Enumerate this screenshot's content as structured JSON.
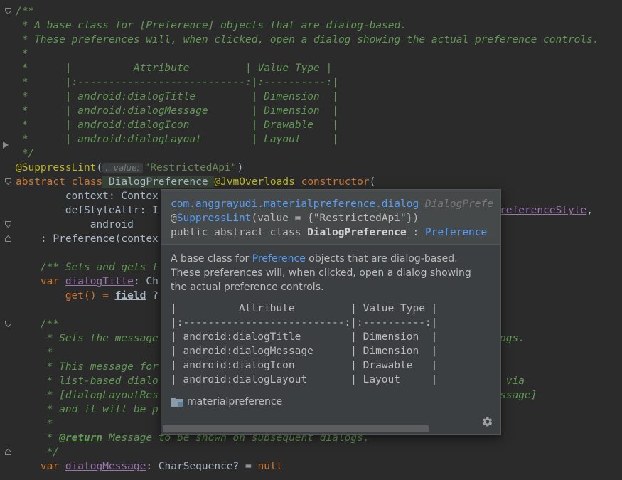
{
  "editor": {
    "lines": {
      "l1": "/**",
      "l2": " * A base class for [Preference] objects that are dialog-based.",
      "l3": " * These preferences will, when clicked, open a dialog showing the actual preference controls.",
      "l4": " *",
      "l5": " *      |          Attribute         | Value Type |",
      "l6": " *      |:---------------------------:|:----------:|",
      "l7": " *      | android:dialogTitle         | Dimension  |",
      "l8": " *      | android:dialogMessage       | Dimension  |",
      "l9": " *      | android:dialogIcon          | Drawable   |",
      "l10": " *      | android:dialogLayout        | Layout     |",
      "l11": " */",
      "l12_ann": "@SuppressLint",
      "l12_open": "(",
      "l12_hint": "...value:",
      "l12_str": "\"RestrictedApi\"",
      "l12_close": ")",
      "l13_kw1": "abstract class",
      "l13_name": " DialogPreference ",
      "l13_ann": "@JvmOverloads",
      "l13_kw2": " constructor",
      "l13_rest": "(",
      "l14": "        context: Contex",
      "l15": "        defStyleAttr: I",
      "l15_right": "referenceStyle",
      "l15_tail": ",",
      "l16": "            android",
      "l17": "    : Preference(contex",
      "l19": "    /** Sets and gets t",
      "l20_kw": "    var ",
      "l20_prop": "dialogTitle",
      "l20_rest": ": Ch",
      "l21_a": "        get() = ",
      "l21_field": "field",
      "l21_b": " ?",
      "l23": "    /**",
      "l24": "     * Sets the message",
      "l24_right": "ogs.",
      "l25": "     *",
      "l26": "     * This message for",
      "l27": "     * list-based dialo",
      "l27_right": " via",
      "l28": "     * [dialogLayoutRes",
      "l28_right": "ssage]",
      "l29": "     * and it will be p",
      "l30": "     *",
      "l31_star": "     * ",
      "l31_tag": "@return",
      "l31_rest": " Message to be shown on subsequent dialogs.",
      "l32": "     */",
      "l33_kw": "    var ",
      "l33_prop": "dialogMessage",
      "l33_rest": ": CharSequence? = ",
      "l33_null": "null"
    }
  },
  "quick_doc": {
    "package": "com.anggrayudi.materialpreference.dialog",
    "package_suffix": " DialogPrefe",
    "annotation_at": "@",
    "annotation_name": "SuppressLint",
    "annotation_args": "(value = {\"RestrictedApi\"})",
    "decl_prefix": "public abstract class ",
    "decl_name": "DialogPreference",
    "decl_colon": " : ",
    "decl_super": "Preference",
    "desc_a": "A base class for ",
    "desc_link": "Preference",
    "desc_b": " objects that are dialog-based. These preferences will, when clicked, open a dialog showing the actual preference controls.",
    "table": [
      "|          Attribute         | Value Type |",
      "|:--------------------------:|:----------:|",
      "| android:dialogTitle        | Dimension  |",
      "| android:dialogMessage      | Dimension  |",
      "| android:dialogIcon         | Drawable   |",
      "| android:dialogLayout       | Layout     |"
    ],
    "module": "materialpreference"
  },
  "colors": {
    "background": "#2b2b2b",
    "popup_bg": "#3c3f41",
    "doc_comment": "#629755",
    "keyword": "#cc7832",
    "annotation": "#bbb529",
    "string": "#6a8759",
    "link": "#589df6"
  },
  "icons": [
    "fold-icon",
    "folder-icon",
    "gear-icon",
    "breakpoint-arrow-icon"
  ]
}
